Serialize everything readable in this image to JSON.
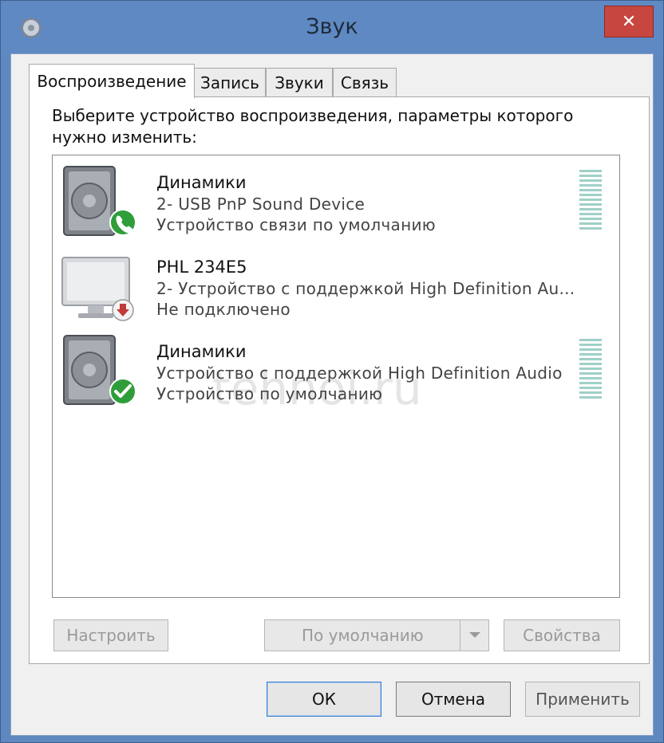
{
  "window": {
    "title": "Звук",
    "close_glyph": "✕"
  },
  "tabs": [
    {
      "label": "Воспроизведение",
      "active": true
    },
    {
      "label": "Запись",
      "active": false
    },
    {
      "label": "Звуки",
      "active": false
    },
    {
      "label": "Связь",
      "active": false
    }
  ],
  "panel": {
    "instruction": "Выберите устройство воспроизведения, параметры которого нужно изменить:",
    "watermark": "tehnoi.ru",
    "devices": [
      {
        "name": "Динамики",
        "description": "2- USB PnP Sound Device",
        "status": "Устройство связи по умолчанию",
        "icon": "speaker-icon",
        "badge": "phone-badge-icon",
        "badge_color": "#2f9e3a"
      },
      {
        "name": "PHL 234E5",
        "description": "2- Устройство с поддержкой High Definition Au...",
        "status": "Не подключено",
        "icon": "monitor-icon",
        "badge": "disconnected-arrow-icon",
        "badge_color": "#c03a3a"
      },
      {
        "name": "Динамики",
        "description": "Устройство с поддержкой High Definition Audio",
        "status": "Устройство по умолчанию",
        "icon": "speaker-icon",
        "badge": "checkmark-badge-icon",
        "badge_color": "#2f9e3a"
      }
    ]
  },
  "buttons": {
    "configure": "Настроить",
    "set_default": "По умолчанию",
    "properties": "Свойства",
    "ok": "ОК",
    "cancel": "Отмена",
    "apply": "Применить"
  },
  "colors": {
    "title_bar": "#5f89c2",
    "close_button": "#c7463f",
    "panel": "#ffffff",
    "dialog": "#f0f0f0"
  }
}
